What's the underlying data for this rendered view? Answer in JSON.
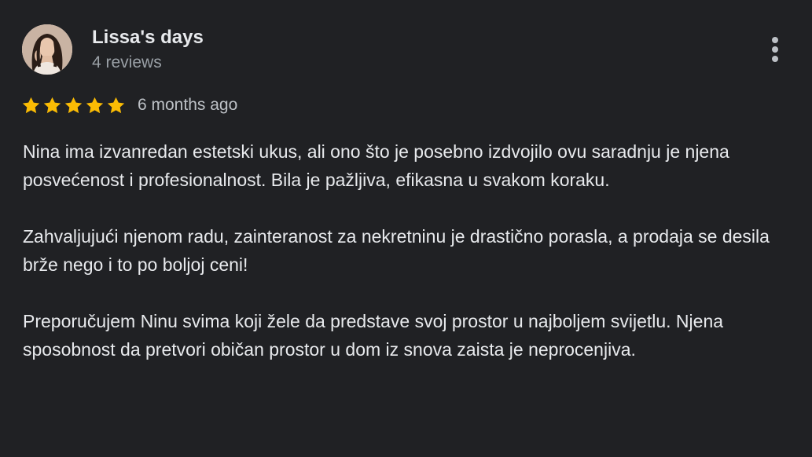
{
  "reviewer": {
    "name": "Lissa's days",
    "review_count": "4 reviews",
    "avatar_icon": "profile-photo"
  },
  "actions": {
    "more_icon": "more-vert-icon"
  },
  "rating": {
    "stars": 5,
    "max_stars": 5,
    "star_color": "#fbbc04",
    "date": "6 months ago"
  },
  "review": {
    "paragraphs": [
      "Nina ima izvanredan estetski ukus, ali ono što je posebno izdvojilo ovu saradnju je njena posvećenost i profesionalnost. Bila je pažljiva, efikasna u svakom koraku.",
      "Zahvaljujući njenom radu, zainteranost za nekretninu je drastično porasla, a prodaja se desila brže nego i to po boljoj ceni!",
      "Preporučujem Ninu svima koji žele da predstave svoj prostor u najboljem svijetlu. Njena sposobnost da pretvori običan prostor u dom iz snova zaista je neprocenjiva."
    ]
  },
  "colors": {
    "background": "#202124",
    "primary_text": "#e8eaed",
    "secondary_text": "#9aa0a6"
  }
}
